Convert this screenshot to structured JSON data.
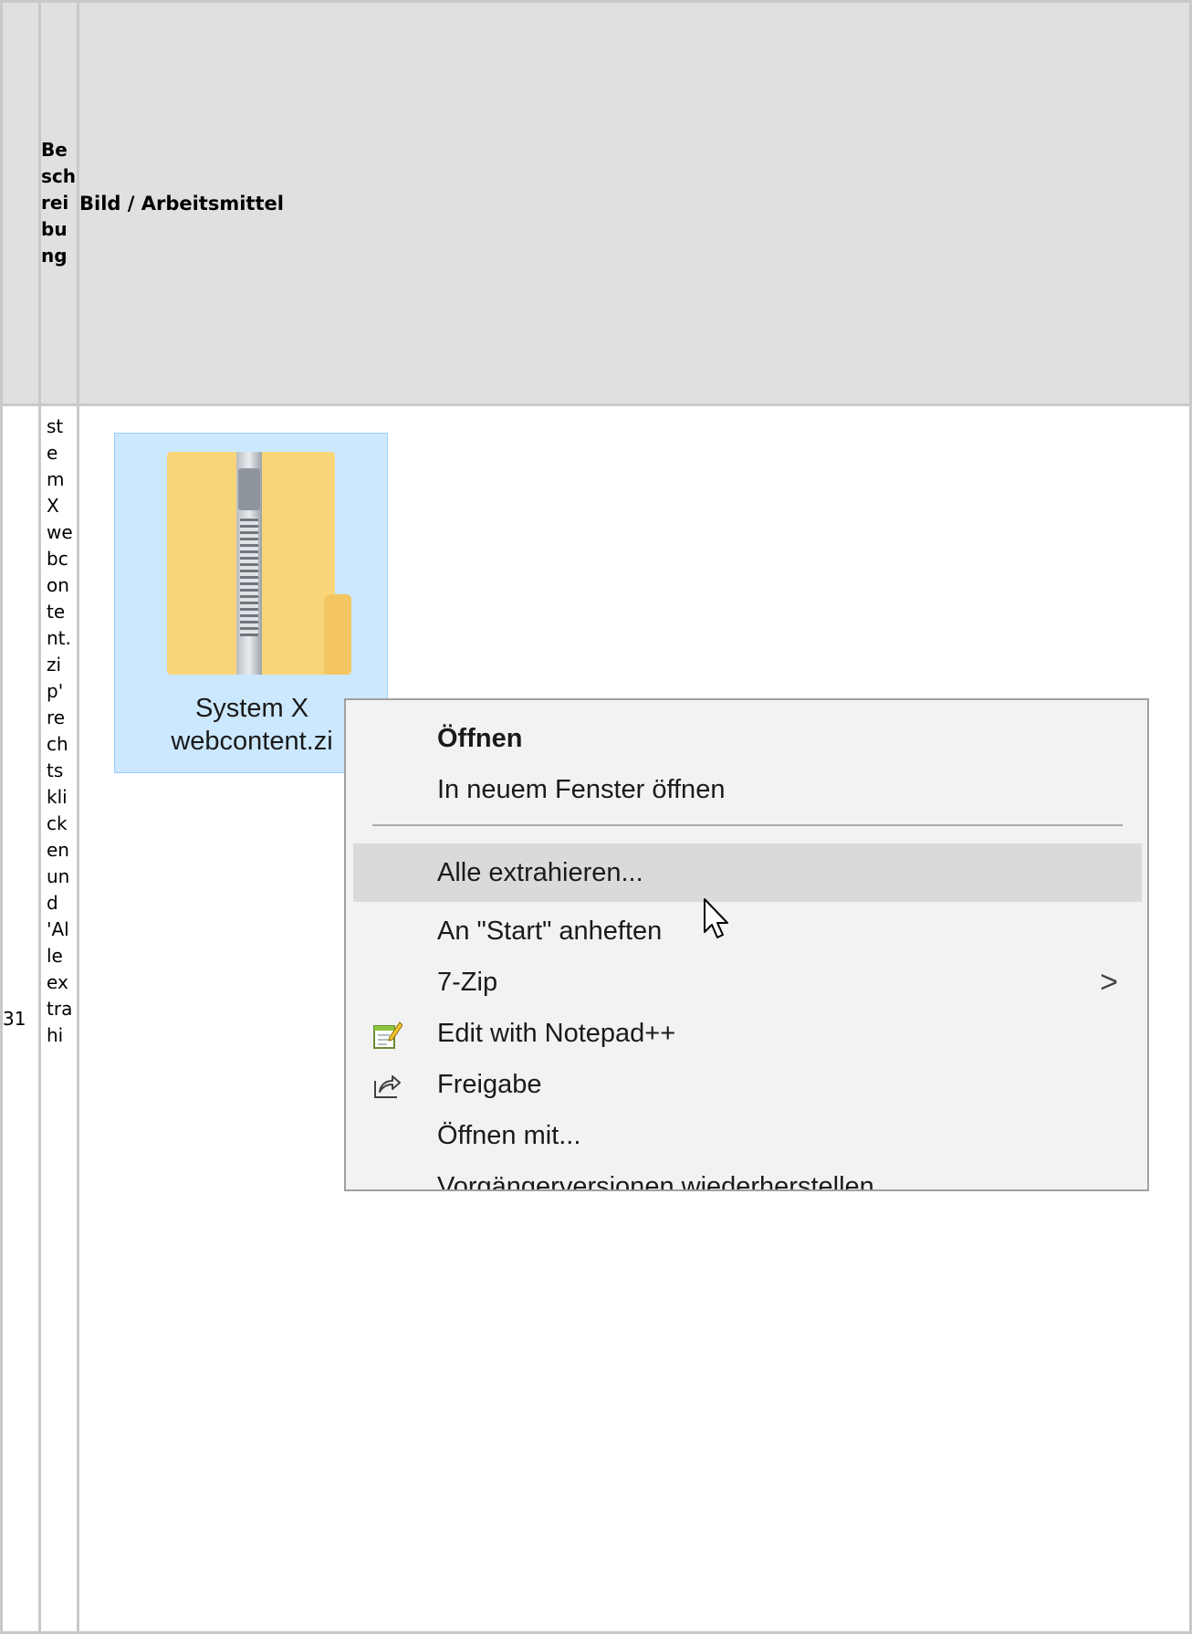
{
  "table": {
    "header": {
      "desc": "Beschreibung",
      "bild": "Bild / Arbeitsmittel"
    },
    "rows": [
      {
        "number": "31",
        "description": "stemXwebcontent.zip' rechtsklicken und 'Alle extrahi"
      }
    ]
  },
  "file_icon": {
    "name_line1": "System X",
    "name_line2": "webcontent.zi"
  },
  "context_menu": {
    "items": [
      {
        "label": "Öffnen"
      },
      {
        "label": "In neuem Fenster öffnen"
      },
      {
        "label": "Alle extrahieren..."
      },
      {
        "label": "An \"Start\" anheften"
      },
      {
        "label": "7-Zip",
        "submenu_arrow": ">"
      },
      {
        "label": "Edit with Notepad++",
        "icon": "notepad-plus-plus-icon"
      },
      {
        "label": "Freigabe",
        "icon": "share-icon"
      },
      {
        "label": "Öffnen mit..."
      },
      {
        "label": "Vorgängerversionen wiederherstellen"
      }
    ],
    "hovered_item": "Alle extrahieren..."
  }
}
